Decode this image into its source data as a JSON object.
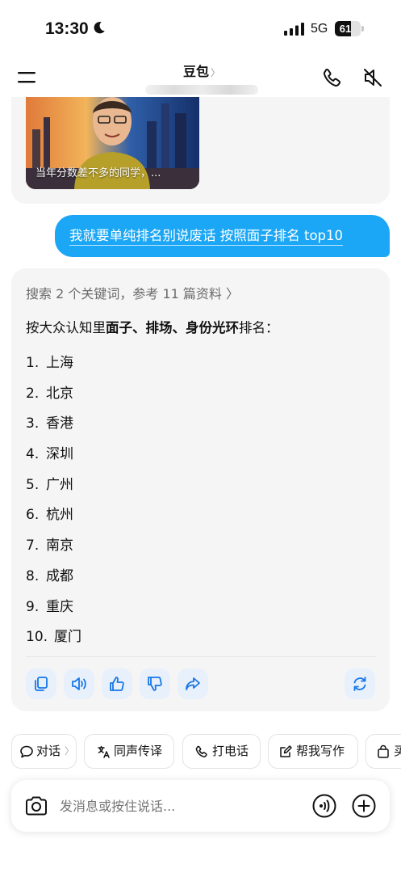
{
  "status_bar": {
    "time": "13:30",
    "network": "5G",
    "battery_level": "61",
    "battery_fraction": 0.61
  },
  "header": {
    "title": "豆包",
    "title_chevron": "〉",
    "icons": [
      "menu-icon",
      "phone-icon",
      "speaker-mute-icon"
    ]
  },
  "previous_card": {
    "video_caption": "当年分数差不多的同学，..."
  },
  "user_message": {
    "text": "我就要单纯排名别说废话 按照面子排名 top10"
  },
  "answer": {
    "search_info": "搜索 2 个关键词，参考 11 篇资料 〉",
    "intro_prefix": "按大众认知里",
    "intro_bold": "面子、排场、身份光环",
    "intro_suffix": "排名：",
    "ranking": [
      {
        "num": "1.",
        "city": "上海"
      },
      {
        "num": "2.",
        "city": "北京"
      },
      {
        "num": "3.",
        "city": "香港"
      },
      {
        "num": "4.",
        "city": "深圳"
      },
      {
        "num": "5.",
        "city": "广州"
      },
      {
        "num": "6.",
        "city": "杭州"
      },
      {
        "num": "7.",
        "city": "南京"
      },
      {
        "num": "8.",
        "city": "成都"
      },
      {
        "num": "9.",
        "city": "重庆"
      },
      {
        "num": "10.",
        "city": "厦门"
      }
    ],
    "actions": [
      "copy-icon",
      "speaker-icon",
      "thumbs-up-icon",
      "thumbs-down-icon",
      "share-icon",
      "regenerate-icon"
    ]
  },
  "quick_chips": {
    "dialog": "对话",
    "dialog_chevron": "〉",
    "interpret": "同声传译",
    "call": "打电话",
    "write": "帮我写作",
    "partial": "买"
  },
  "input": {
    "placeholder": "发消息或按住说话..."
  },
  "colors": {
    "accent": "#1ba7f5",
    "action_icon": "#1677e8",
    "card_bg": "#f5f5f5"
  }
}
